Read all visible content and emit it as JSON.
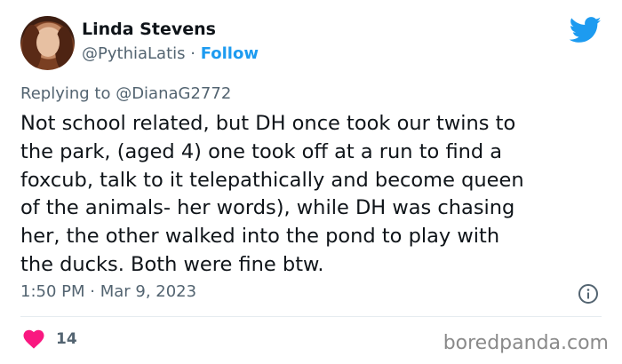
{
  "author": {
    "name": "Linda Stevens",
    "handle": "@PythiaLatis",
    "separator": "·",
    "follow_label": "Follow"
  },
  "reply": {
    "text": "Replying to @DianaG2772"
  },
  "tweet": {
    "lines": [
      "Not school related, but DH once took our twins to",
      "the park, (aged 4) one took off at a run to find a",
      "foxcub, talk to it telepathically and become queen",
      "of the animals- her words), while DH was chasing",
      "her, the other walked into the pond to play with",
      "the ducks. Both were fine btw."
    ],
    "timestamp": "1:50 PM · Mar 9, 2023",
    "likes": "14"
  },
  "icons": {
    "brand": "twitter-bird-icon",
    "info": "info-icon",
    "like": "heart-icon"
  },
  "colors": {
    "accent": "#1d9bf0",
    "like": "#f91880",
    "muted": "#536471"
  },
  "watermark": "boredpanda.com"
}
